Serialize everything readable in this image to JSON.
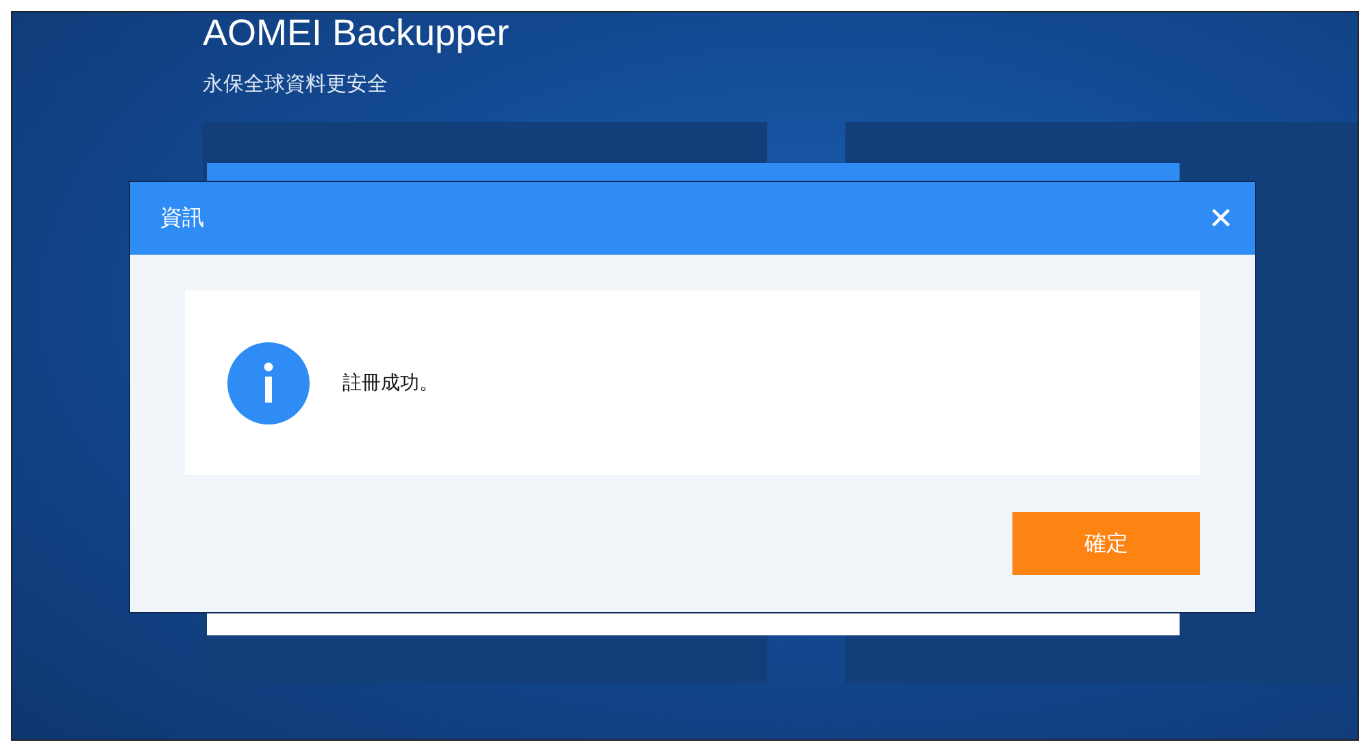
{
  "app": {
    "title": "AOMEI Backupper",
    "subtitle": "永保全球資料更安全"
  },
  "dialog": {
    "title": "資訊",
    "close": "✕",
    "message": "註冊成功。",
    "buttons": [
      {
        "label": "確定",
        "kind": "primary"
      }
    ]
  }
}
